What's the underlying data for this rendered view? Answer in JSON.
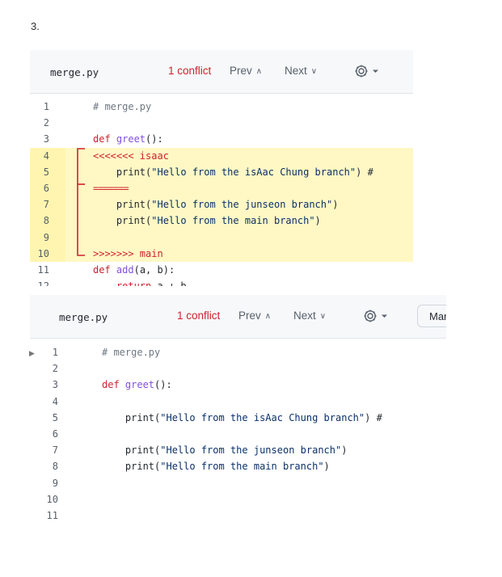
{
  "step_label": "3.",
  "panel1": {
    "filename": "merge.py",
    "conflict_label": "1 conflict",
    "prev_label": "Prev",
    "next_label": "Next",
    "lines": [
      {
        "n": "1",
        "text": "# merge.py",
        "cls": "cmt"
      },
      {
        "n": "2",
        "text": ""
      },
      {
        "n": "3",
        "parts": [
          {
            "t": "def ",
            "c": "kw"
          },
          {
            "t": "greet",
            "c": "fn"
          },
          {
            "t": "():",
            "c": ""
          }
        ]
      },
      {
        "n": "4",
        "text": "<<<<<<< isaac",
        "cls": "mk",
        "hl": true
      },
      {
        "n": "5",
        "parts": [
          {
            "t": "    print(",
            "c": ""
          },
          {
            "t": "\"Hello from the isAac Chung branch\"",
            "c": "str"
          },
          {
            "t": ") #",
            "c": ""
          }
        ],
        "hl": true
      },
      {
        "n": "6",
        "text": "=======",
        "cls": "sep",
        "hl": true
      },
      {
        "n": "7",
        "parts": [
          {
            "t": "    print(",
            "c": ""
          },
          {
            "t": "\"Hello from the junseon branch\"",
            "c": "str"
          },
          {
            "t": ")",
            "c": ""
          }
        ],
        "hl": true
      },
      {
        "n": "8",
        "parts": [
          {
            "t": "    print(",
            "c": ""
          },
          {
            "t": "\"Hello from the main branch\"",
            "c": "str"
          },
          {
            "t": ")",
            "c": ""
          }
        ],
        "hl": true
      },
      {
        "n": "9",
        "text": "",
        "hl": true
      },
      {
        "n": "10",
        "text": ">>>>>>> main",
        "cls": "mk",
        "hl": true
      },
      {
        "n": "11",
        "parts": [
          {
            "t": "def ",
            "c": "kw"
          },
          {
            "t": "add",
            "c": "fn"
          },
          {
            "t": "(a, b):",
            "c": ""
          }
        ]
      },
      {
        "n": "12",
        "parts": [
          {
            "t": "    return ",
            "c": "kw"
          },
          {
            "t": "a + b",
            "c": ""
          }
        ]
      }
    ]
  },
  "panel2": {
    "filename": "merge.py",
    "conflict_label": "1 conflict",
    "prev_label": "Prev",
    "next_label": "Next",
    "mark_button_label": "Mar",
    "lines": [
      {
        "n": "1",
        "text": "# merge.py",
        "cls": "cmt"
      },
      {
        "n": "2",
        "text": ""
      },
      {
        "n": "3",
        "parts": [
          {
            "t": "def ",
            "c": "kw"
          },
          {
            "t": "greet",
            "c": "fn"
          },
          {
            "t": "():",
            "c": ""
          }
        ]
      },
      {
        "n": "4",
        "text": ""
      },
      {
        "n": "5",
        "parts": [
          {
            "t": "    print(",
            "c": ""
          },
          {
            "t": "\"Hello from the isAac Chung branch\"",
            "c": "str"
          },
          {
            "t": ") #",
            "c": ""
          }
        ]
      },
      {
        "n": "6",
        "text": ""
      },
      {
        "n": "7",
        "parts": [
          {
            "t": "    print(",
            "c": ""
          },
          {
            "t": "\"Hello from the junseon branch\"",
            "c": "str"
          },
          {
            "t": ")",
            "c": ""
          }
        ]
      },
      {
        "n": "8",
        "parts": [
          {
            "t": "    print(",
            "c": ""
          },
          {
            "t": "\"Hello from the main branch\"",
            "c": "str"
          },
          {
            "t": ")",
            "c": ""
          }
        ]
      },
      {
        "n": "9",
        "text": ""
      },
      {
        "n": "10",
        "text": ""
      },
      {
        "n": "11",
        "text": ""
      }
    ]
  },
  "colors": {
    "conflict_red": "#cf222e",
    "highlight_yellow": "#fff5b1",
    "bracket_red": "#cf222e"
  }
}
